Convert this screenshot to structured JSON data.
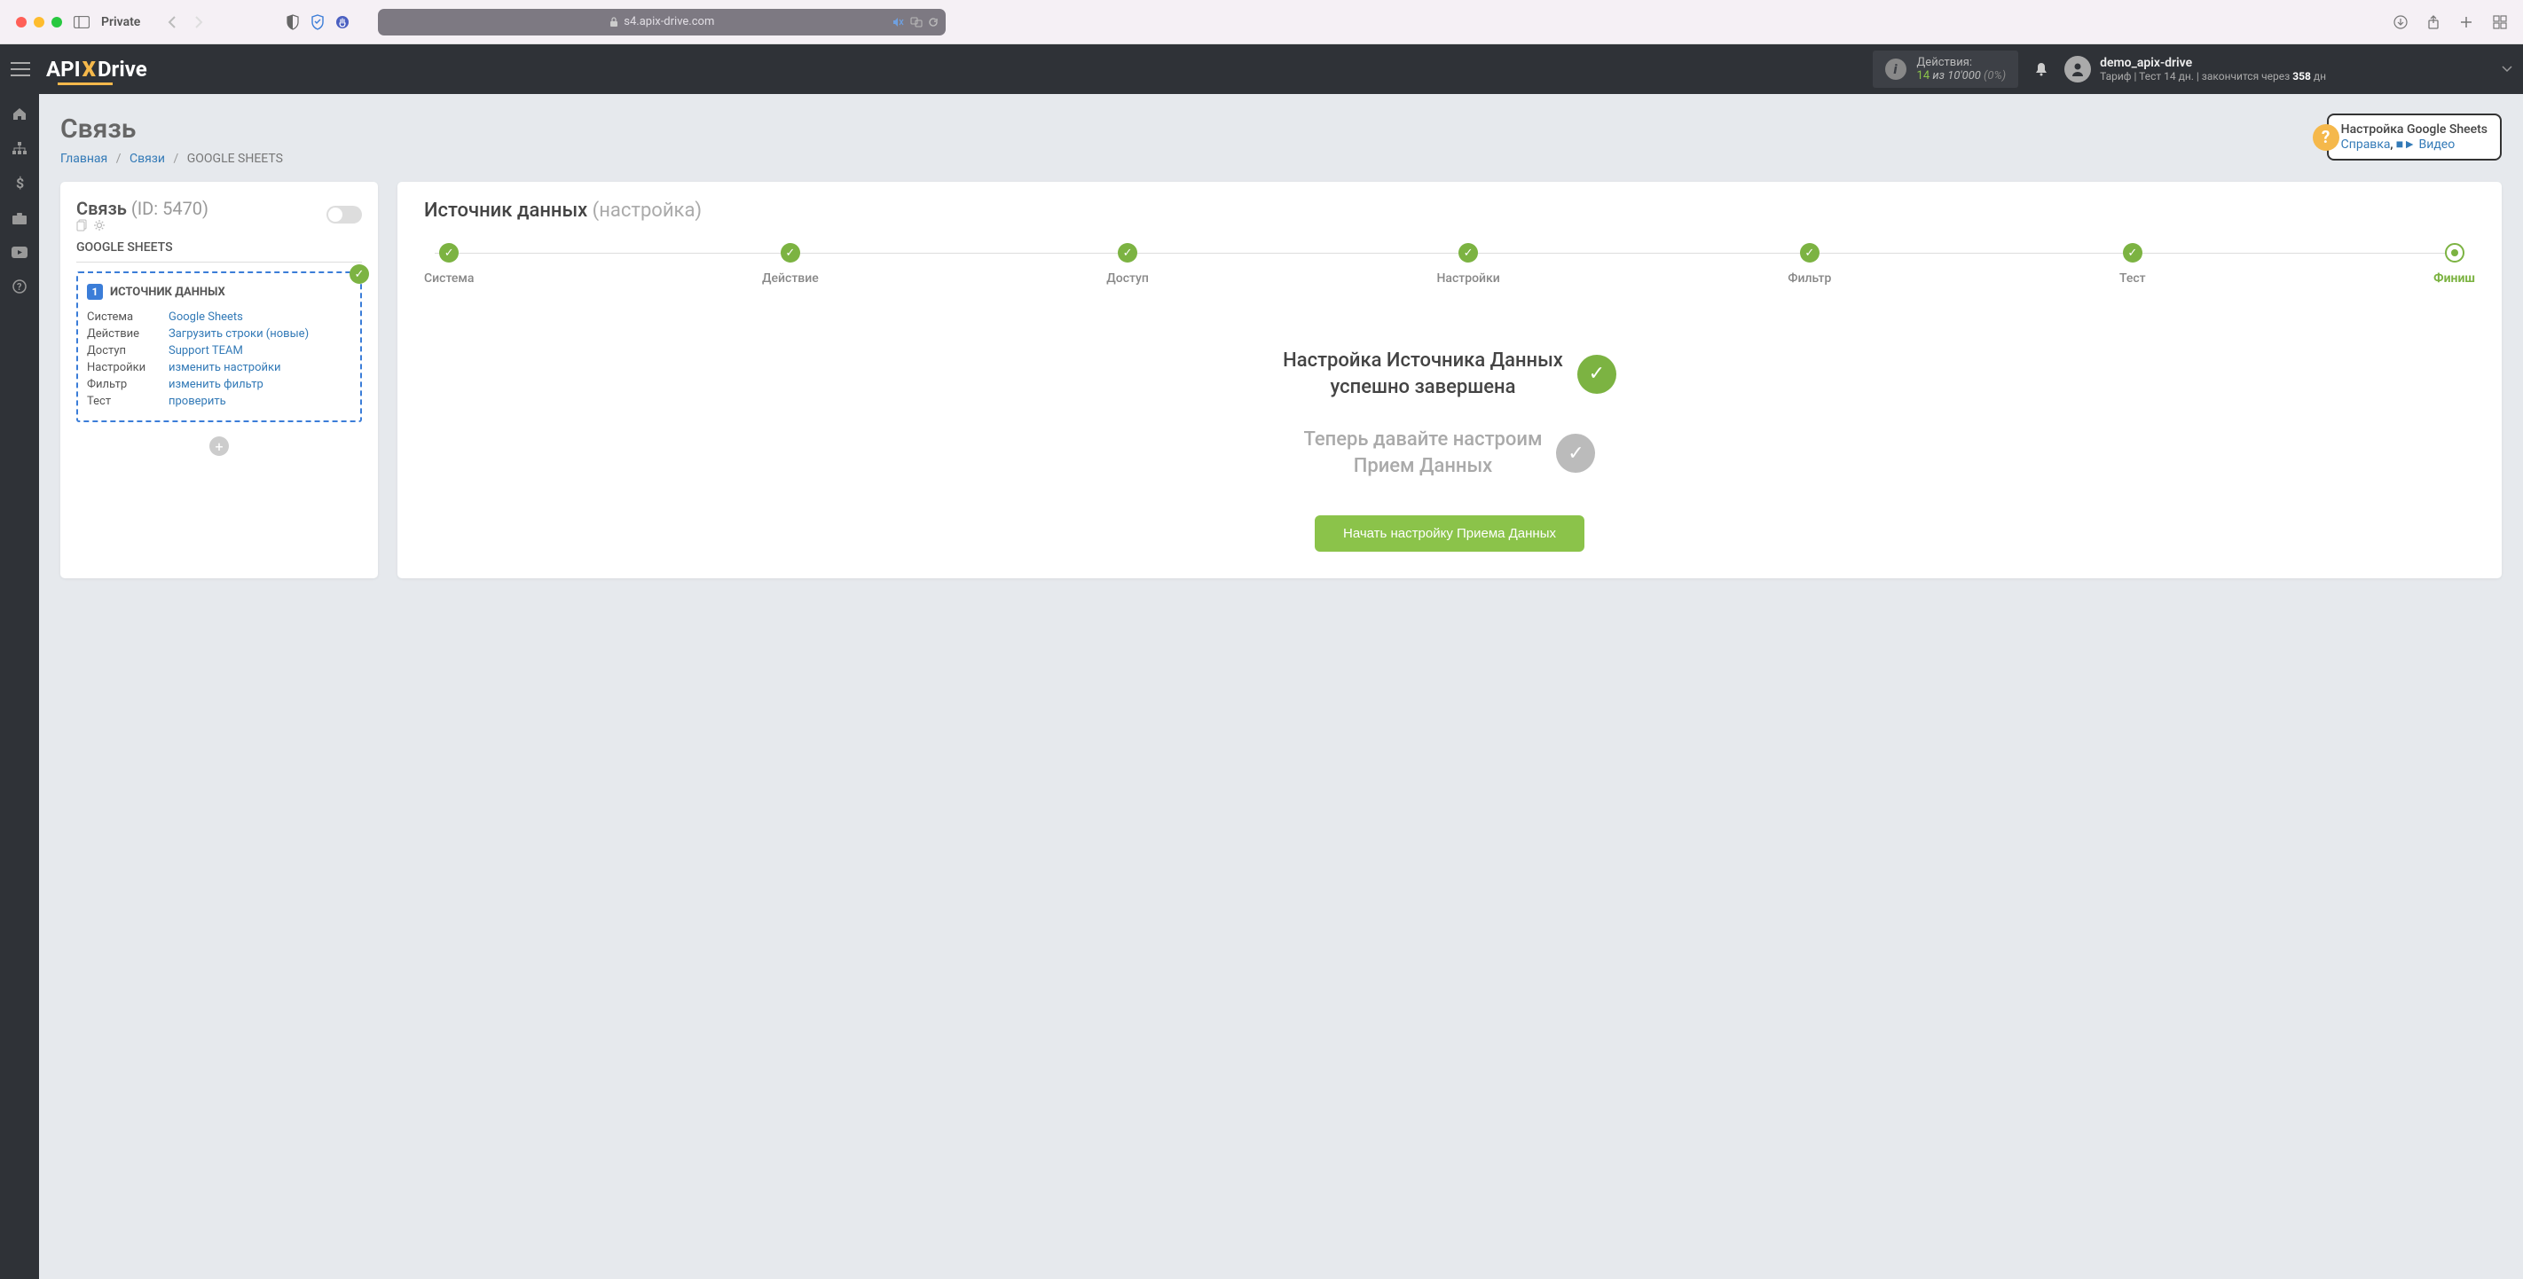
{
  "browser": {
    "private": "Private",
    "url": "s4.apix-drive.com"
  },
  "header": {
    "logo_api": "API",
    "logo_drive": "Drive",
    "actions_label": "Действия:",
    "actions_used": "14",
    "actions_of": " из ",
    "actions_total": "10'000",
    "actions_pct": " (0%)",
    "username": "demo_apix-drive",
    "tariff_prefix": "Тариф | Тест 14 дн. | закончится через ",
    "tariff_days": "358",
    "tariff_suffix": " дн"
  },
  "page": {
    "title": "Связь",
    "bc_home": "Главная",
    "bc_links": "Связи",
    "bc_current": "GOOGLE SHEETS",
    "help_title": "Настройка Google Sheets",
    "help_ref": "Справка",
    "help_video": "Видео"
  },
  "left": {
    "title_label": "Связь ",
    "title_id": "(ID: 5470)",
    "subtitle": "GOOGLE SHEETS",
    "card_title": "ИСТОЧНИК ДАННЫХ",
    "rows": {
      "system_k": "Система",
      "system_v": "Google Sheets",
      "action_k": "Действие",
      "action_v": "Загрузить строки (новые)",
      "access_k": "Доступ",
      "access_v": "Support TEAM",
      "settings_k": "Настройки",
      "settings_v": "изменить настройки",
      "filter_k": "Фильтр",
      "filter_v": "изменить фильтр",
      "test_k": "Тест",
      "test_v": "проверить"
    }
  },
  "right": {
    "title": "Источник данных ",
    "subtitle": "(настройка)",
    "steps": {
      "s1": "Система",
      "s2": "Действие",
      "s3": "Доступ",
      "s4": "Настройки",
      "s5": "Фильтр",
      "s6": "Тест",
      "s7": "Финиш"
    },
    "done_line1": "Настройка Источника Данных",
    "done_line2": "успешно завершена",
    "next_line1": "Теперь давайте настроим",
    "next_line2": "Прием Данных",
    "button": "Начать настройку Приема Данных"
  }
}
